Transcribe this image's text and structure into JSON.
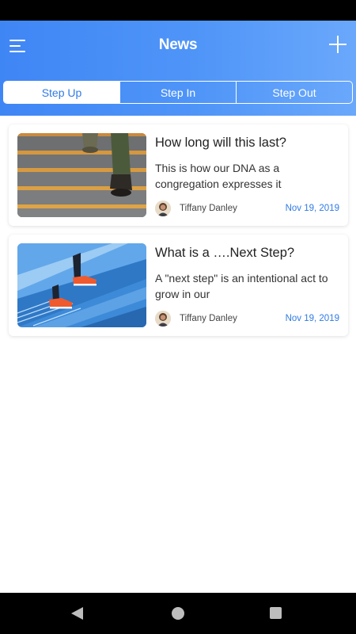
{
  "header": {
    "title": "News",
    "menu_icon": "menu-icon",
    "add_icon": "plus-icon"
  },
  "tabs": [
    {
      "label": "Step Up",
      "active": true
    },
    {
      "label": "Step In",
      "active": false
    },
    {
      "label": "Step Out",
      "active": false
    }
  ],
  "articles": [
    {
      "title": "How long will this last?",
      "excerpt": "This is how our DNA as a congregation expresses it",
      "author": "Tiffany Danley",
      "date": "Nov 19, 2019",
      "image": "stairs-with-boots"
    },
    {
      "title": "What is a ….Next Step?",
      "excerpt": "A \"next step\" is an intentional act to grow in our",
      "author": "Tiffany Danley",
      "date": "Nov 19, 2019",
      "image": "blue-stairs-with-orange-shoes"
    }
  ],
  "colors": {
    "header_gradient_start": "#3f86f5",
    "header_gradient_end": "#6aa8fb",
    "accent": "#2f7be6"
  },
  "system_nav": {
    "back_icon": "back-icon",
    "home_icon": "home-icon",
    "recents_icon": "recents-icon"
  }
}
